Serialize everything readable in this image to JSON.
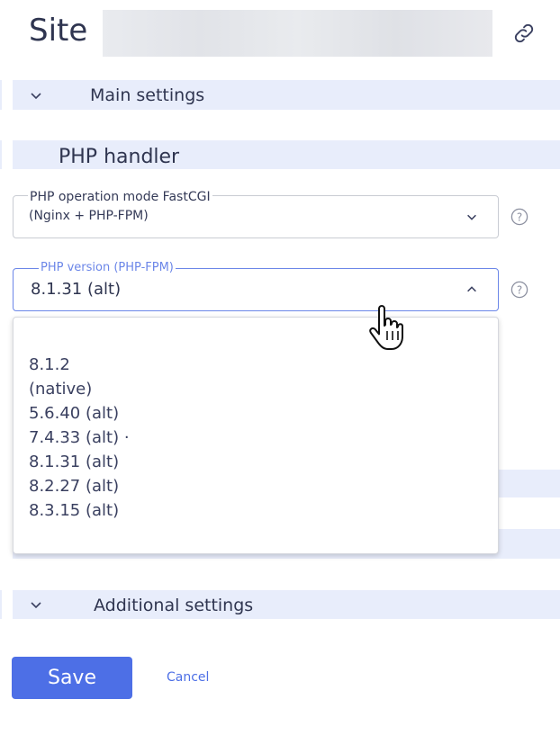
{
  "header": {
    "title": "Site"
  },
  "icons": {
    "link": "link-icon",
    "help": "question-circle-icon",
    "chevron": "chevron-icon",
    "cursor": "hand-pointer-icon"
  },
  "sections": {
    "main": "Main settings",
    "php_handler": "PHP handler",
    "additional": "Additional settings"
  },
  "fields": {
    "operation_mode": {
      "label": "PHP operation mode FastCGI",
      "value": "(Nginx + PHP-FPM)"
    },
    "php_version": {
      "label": "PHP version (PHP-FPM)",
      "value": "8.1.31 (alt)"
    }
  },
  "dropdown": {
    "options": [
      "8.1.2",
      "(native)",
      "5.6.40 (alt)",
      "7.4.33 (alt) ·",
      "8.1.31 (alt)",
      "8.2.27 (alt)",
      "8.3.15 (alt)"
    ]
  },
  "actions": {
    "save": "Save",
    "cancel": "Cancel"
  },
  "colors": {
    "accent": "#4d6fe6",
    "band": "#e8edfb",
    "text": "#2f3550"
  }
}
